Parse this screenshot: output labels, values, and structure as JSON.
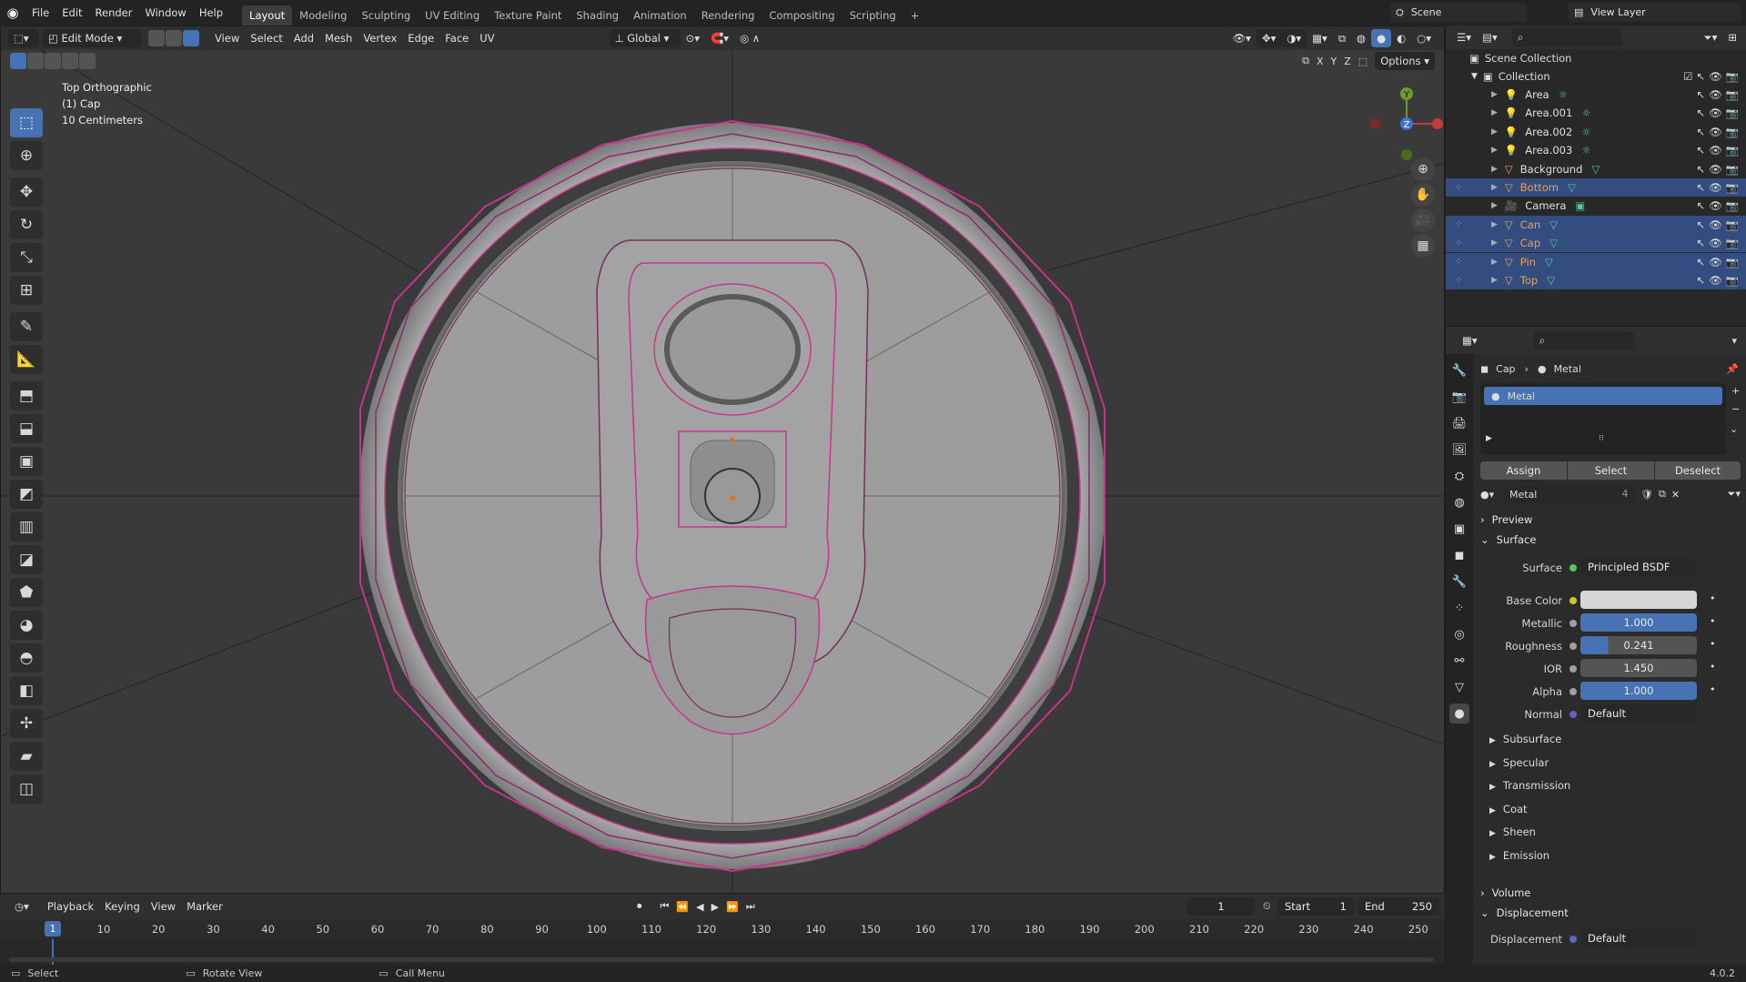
{
  "menubar": {
    "items": [
      "File",
      "Edit",
      "Render",
      "Window",
      "Help"
    ],
    "workspaces": [
      "Layout",
      "Modeling",
      "Sculpting",
      "UV Editing",
      "Texture Paint",
      "Shading",
      "Animation",
      "Rendering",
      "Compositing",
      "Scripting"
    ],
    "active_workspace": "Layout",
    "add_tab": "+",
    "scene": "Scene",
    "view_layer": "View Layer"
  },
  "viewport": {
    "mode": "Edit Mode",
    "menus": [
      "View",
      "Select",
      "Add",
      "Mesh",
      "Vertex",
      "Edge",
      "Face",
      "UV"
    ],
    "orientation": "Global",
    "axis_x": "X",
    "axis_y": "Y",
    "axis_z": "Z",
    "options": "Options",
    "info_line1": "Top Orthographic",
    "info_line2": "(1) Cap",
    "info_line3": "10 Centimeters",
    "gizmo_y": "Y",
    "gizmo_z": "Z"
  },
  "timeline": {
    "menus": [
      "Playback",
      "Keying",
      "View",
      "Marker"
    ],
    "current_frame": "1",
    "start_label": "Start",
    "start": "1",
    "end_label": "End",
    "end": "250",
    "ruler": [
      "10",
      "20",
      "30",
      "40",
      "50",
      "60",
      "70",
      "80",
      "90",
      "100",
      "110",
      "120",
      "130",
      "140",
      "150",
      "160",
      "170",
      "180",
      "190",
      "200",
      "210",
      "220",
      "230",
      "240",
      "250"
    ],
    "playhead": "1"
  },
  "status": {
    "select": "Select",
    "rotate": "Rotate View",
    "call_menu": "Call Menu",
    "version": "4.0.2"
  },
  "outliner": {
    "root": "Scene Collection",
    "collection": "Collection",
    "items": [
      {
        "name": "Area",
        "type": "light",
        "selected": false
      },
      {
        "name": "Area.001",
        "type": "light",
        "selected": false
      },
      {
        "name": "Area.002",
        "type": "light",
        "selected": false
      },
      {
        "name": "Area.003",
        "type": "light",
        "selected": false
      },
      {
        "name": "Background",
        "type": "mesh",
        "selected": false
      },
      {
        "name": "Bottom",
        "type": "mesh",
        "selected": true
      },
      {
        "name": "Camera",
        "type": "camera",
        "selected": false
      },
      {
        "name": "Can",
        "type": "mesh",
        "selected": true
      },
      {
        "name": "Cap",
        "type": "mesh",
        "selected": true
      },
      {
        "name": "Pin",
        "type": "mesh",
        "selected": true
      },
      {
        "name": "Top",
        "type": "mesh",
        "selected": true
      }
    ]
  },
  "properties": {
    "breadcrumb_object": "Cap",
    "breadcrumb_material": "Metal",
    "slot": "Metal",
    "assign": "Assign",
    "select": "Select",
    "deselect": "Deselect",
    "material_name": "Metal",
    "users": "4",
    "preview": "Preview",
    "surface_panel": "Surface",
    "surface_label": "Surface",
    "surface_value": "Principled BSDF",
    "base_color_label": "Base Color",
    "base_color": "#d6d6d6",
    "metallic_label": "Metallic",
    "metallic": "1.000",
    "roughness_label": "Roughness",
    "roughness": "0.241",
    "ior_label": "IOR",
    "ior": "1.450",
    "alpha_label": "Alpha",
    "alpha": "1.000",
    "normal_label": "Normal",
    "normal": "Default",
    "subpanels": [
      "Subsurface",
      "Specular",
      "Transmission",
      "Coat",
      "Sheen",
      "Emission"
    ],
    "volume": "Volume",
    "displacement_panel": "Displacement",
    "displacement_label": "Displacement",
    "displacement": "Default"
  },
  "colors": {
    "accent": "#4772b3",
    "selected_edge": "#c8348c",
    "viewport_bg": "#3a3a3a",
    "object_orange": "#e8a060"
  }
}
